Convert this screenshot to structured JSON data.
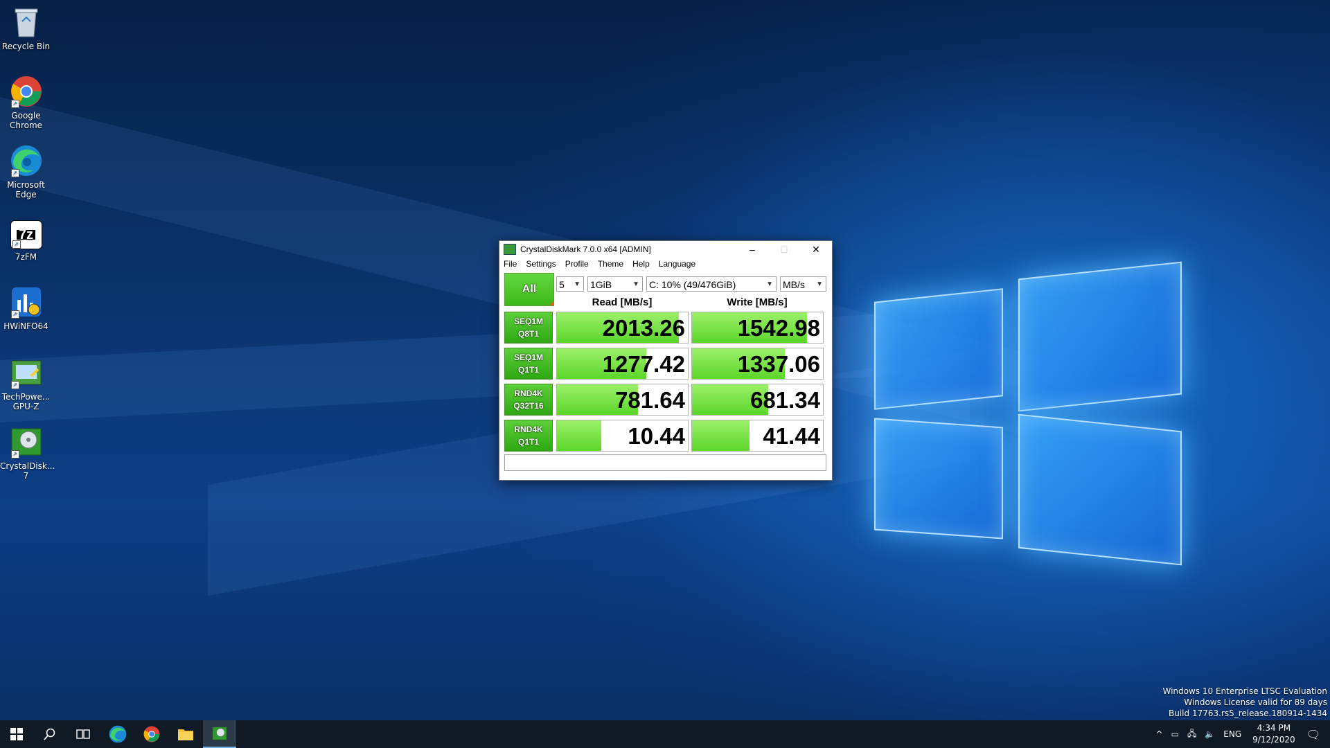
{
  "desktop": {
    "icons": [
      {
        "label": "Recycle Bin"
      },
      {
        "label": "Google Chrome"
      },
      {
        "label": "Microsoft Edge"
      },
      {
        "label": "7zFM",
        "glyph_text": "7z"
      },
      {
        "label": "HWiNFO64"
      },
      {
        "label": "TechPowe... GPU-Z"
      },
      {
        "label": "CrystalDisk... 7"
      }
    ],
    "watermark": {
      "line1": "Windows 10 Enterprise LTSC Evaluation",
      "line2": "Windows License valid for 89 days",
      "line3": "Build 17763.rs5_release.180914-1434"
    }
  },
  "window": {
    "title": "CrystalDiskMark 7.0.0 x64 [ADMIN]",
    "controls": {
      "minimize": "–",
      "maximize": "□",
      "close": "✕"
    },
    "menu": [
      "File",
      "Settings",
      "Profile",
      "Theme",
      "Help",
      "Language"
    ],
    "all_button": "All",
    "options": {
      "count": "5",
      "size": "1GiB",
      "drive": "C: 10% (49/476GiB)",
      "unit": "MB/s"
    },
    "headers": {
      "read": "Read [MB/s]",
      "write": "Write [MB/s]"
    },
    "tests": [
      {
        "line1": "SEQ1M",
        "line2": "Q8T1",
        "read": "2013.26",
        "write": "1542.98",
        "read_fill": 0.93,
        "write_fill": 0.88
      },
      {
        "line1": "SEQ1M",
        "line2": "Q1T1",
        "read": "1277.42",
        "write": "1337.06",
        "read_fill": 0.68,
        "write_fill": 0.71
      },
      {
        "line1": "RND4K",
        "line2": "Q32T16",
        "read": "781.64",
        "write": "681.34",
        "read_fill": 0.62,
        "write_fill": 0.58
      },
      {
        "line1": "RND4K",
        "line2": "Q1T1",
        "read": "10.44",
        "write": "41.44",
        "read_fill": 0.34,
        "write_fill": 0.44
      }
    ],
    "comment": ""
  },
  "taskbar": {
    "language": "ENG",
    "time": "4:34 PM",
    "date": "9/12/2020"
  },
  "colors": {
    "accent_green": "#5cd62a",
    "taskbar": "#101a24"
  }
}
